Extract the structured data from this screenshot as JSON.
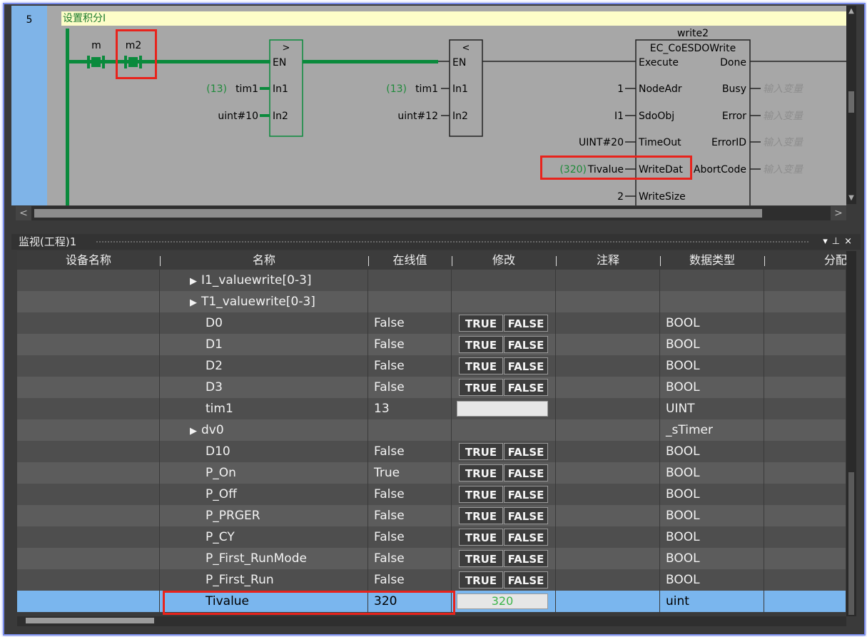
{
  "ladder": {
    "rung_number": "5",
    "rung_comment": "设置积分I",
    "contacts": [
      {
        "label": "m"
      },
      {
        "label": "m2"
      }
    ],
    "gt_block": {
      "op": ">",
      "en": "EN",
      "in1_pin": "In1",
      "in2_pin": "In2",
      "in1_value": "(13)",
      "in1_var": "tim1",
      "in2_var": "uint#10"
    },
    "lt_block": {
      "op": "<",
      "en": "EN",
      "in1_pin": "In1",
      "in2_pin": "In2",
      "in1_value": "(13)",
      "in1_var": "tim1",
      "in2_var": "uint#12"
    },
    "fb": {
      "instance": "write2",
      "type": "EC_CoESDOWrite",
      "inputs": [
        {
          "pin": "Execute",
          "var": ""
        },
        {
          "pin": "NodeAdr",
          "var": "1"
        },
        {
          "pin": "SdoObj",
          "var": "I1"
        },
        {
          "pin": "TimeOut",
          "var": "UINT#20"
        },
        {
          "pin": "WriteDat",
          "var": "Tivalue",
          "value": "(320)"
        },
        {
          "pin": "WriteSize",
          "var": "2"
        }
      ],
      "outputs": [
        {
          "pin": "Done",
          "var": ""
        },
        {
          "pin": "Busy",
          "var": "输入变量"
        },
        {
          "pin": "Error",
          "var": "输入变量"
        },
        {
          "pin": "ErrorID",
          "var": "输入变量"
        },
        {
          "pin": "AbortCode",
          "var": "输入变量"
        }
      ]
    }
  },
  "watch": {
    "title": "监视(工程)1",
    "pin_icon": "pin-icon",
    "columns": [
      "设备名称",
      "名称",
      "在线值",
      "修改",
      "注释",
      "数据类型",
      "分配"
    ],
    "rows": [
      {
        "name": "I1_valuewrite[0-3]",
        "expand": true,
        "online": "",
        "modify": "none",
        "type": ""
      },
      {
        "name": "T1_valuewrite[0-3]",
        "expand": true,
        "online": "",
        "modify": "none",
        "type": ""
      },
      {
        "name": "D0",
        "online": "False",
        "modify": "bool",
        "type": "BOOL"
      },
      {
        "name": "D1",
        "online": "False",
        "modify": "bool",
        "type": "BOOL"
      },
      {
        "name": "D2",
        "online": "False",
        "modify": "bool",
        "type": "BOOL"
      },
      {
        "name": "D3",
        "online": "False",
        "modify": "bool",
        "type": "BOOL"
      },
      {
        "name": "tim1",
        "online": "13",
        "modify": "input",
        "modify_value": "",
        "type": "UINT"
      },
      {
        "name": "dv0",
        "expand": true,
        "online": "",
        "modify": "none",
        "type": "_sTimer"
      },
      {
        "name": "D10",
        "online": "False",
        "modify": "bool",
        "type": "BOOL"
      },
      {
        "name": "P_On",
        "online": "True",
        "modify": "bool",
        "type": "BOOL"
      },
      {
        "name": "P_Off",
        "online": "False",
        "modify": "bool",
        "type": "BOOL"
      },
      {
        "name": "P_PRGER",
        "online": "False",
        "modify": "bool",
        "type": "BOOL"
      },
      {
        "name": "P_CY",
        "online": "False",
        "modify": "bool",
        "type": "BOOL"
      },
      {
        "name": "P_First_RunMode",
        "online": "False",
        "modify": "bool",
        "type": "BOOL"
      },
      {
        "name": "P_First_Run",
        "online": "False",
        "modify": "bool",
        "type": "BOOL"
      },
      {
        "name": "Tivalue",
        "online": "320",
        "modify": "input",
        "modify_value": "320",
        "type": "uint",
        "selected": true
      }
    ],
    "true_label": "TRUE",
    "false_label": "FALSE"
  },
  "colors": {
    "rung_green": "#0a8a3c",
    "value_green": "#1e8a3a",
    "highlight_red": "#e8231c",
    "selected_row": "#7ab6ee"
  }
}
